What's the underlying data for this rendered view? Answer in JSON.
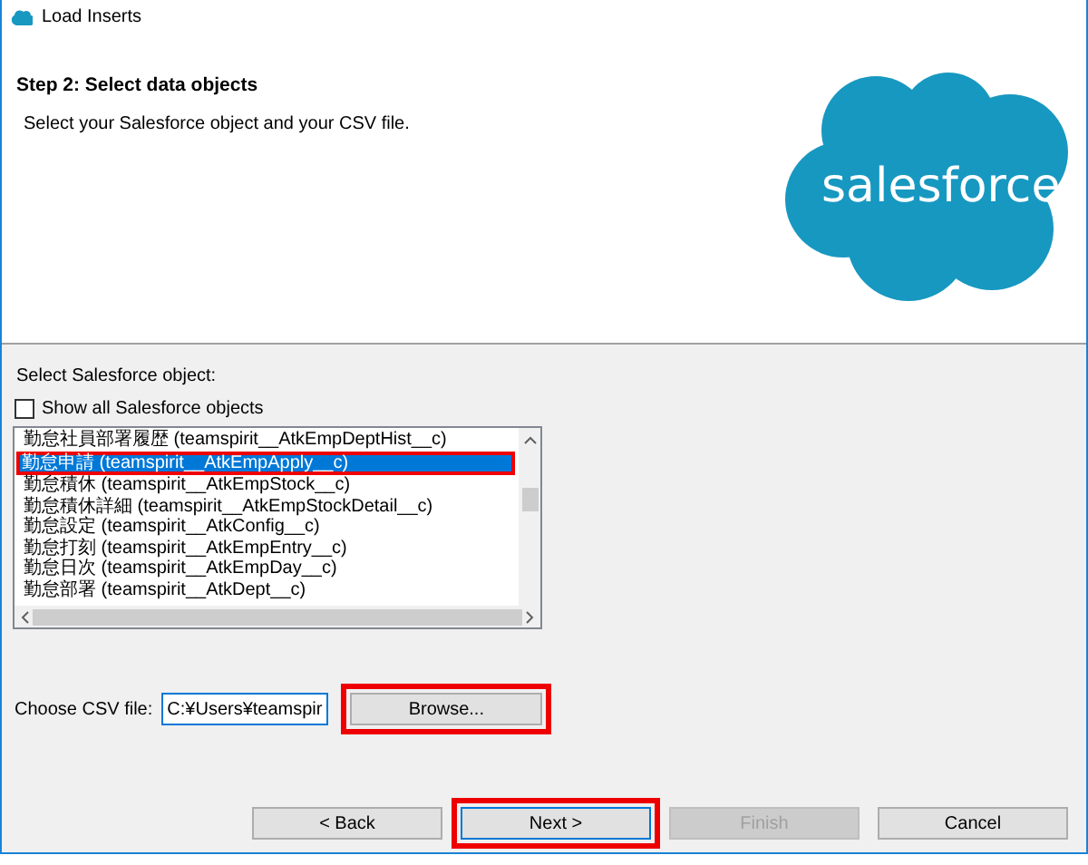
{
  "window": {
    "title": "Load Inserts"
  },
  "header": {
    "heading": "Step 2: Select data objects",
    "subtitle": "Select your Salesforce object and your CSV file.",
    "logo_text": "salesforce"
  },
  "object_picker": {
    "label": "Select Salesforce object:",
    "show_all": {
      "label": "Show all Salesforce objects",
      "checked": false
    },
    "items": [
      {
        "label": "勤怠社員部署履歴 (teamspirit__AtkEmpDeptHist__c)",
        "selected": false,
        "highlighted": false
      },
      {
        "label": "勤怠申請 (teamspirit__AtkEmpApply__c)",
        "selected": true,
        "highlighted": true
      },
      {
        "label": "勤怠積休 (teamspirit__AtkEmpStock__c)",
        "selected": false,
        "highlighted": false
      },
      {
        "label": "勤怠積休詳細 (teamspirit__AtkEmpStockDetail__c)",
        "selected": false,
        "highlighted": false
      },
      {
        "label": "勤怠設定 (teamspirit__AtkConfig__c)",
        "selected": false,
        "highlighted": false
      },
      {
        "label": "勤怠打刻 (teamspirit__AtkEmpEntry__c)",
        "selected": false,
        "highlighted": false
      },
      {
        "label": "勤怠日次 (teamspirit__AtkEmpDay__c)",
        "selected": false,
        "highlighted": false
      },
      {
        "label": "勤怠部署 (teamspirit__AtkDept__c)",
        "selected": false,
        "highlighted": false
      }
    ]
  },
  "csv": {
    "label": "Choose CSV file:",
    "value": "C:¥Users¥teamspir",
    "browse": {
      "label": "Browse...",
      "highlighted": true
    }
  },
  "buttons": [
    {
      "label": "< Back",
      "disabled": false,
      "default": false,
      "highlighted": false
    },
    {
      "label": "Next >",
      "disabled": false,
      "default": true,
      "highlighted": true
    },
    {
      "label": "Finish",
      "disabled": true,
      "default": false,
      "highlighted": false
    },
    {
      "label": "Cancel",
      "disabled": false,
      "default": false,
      "highlighted": false
    }
  ]
}
